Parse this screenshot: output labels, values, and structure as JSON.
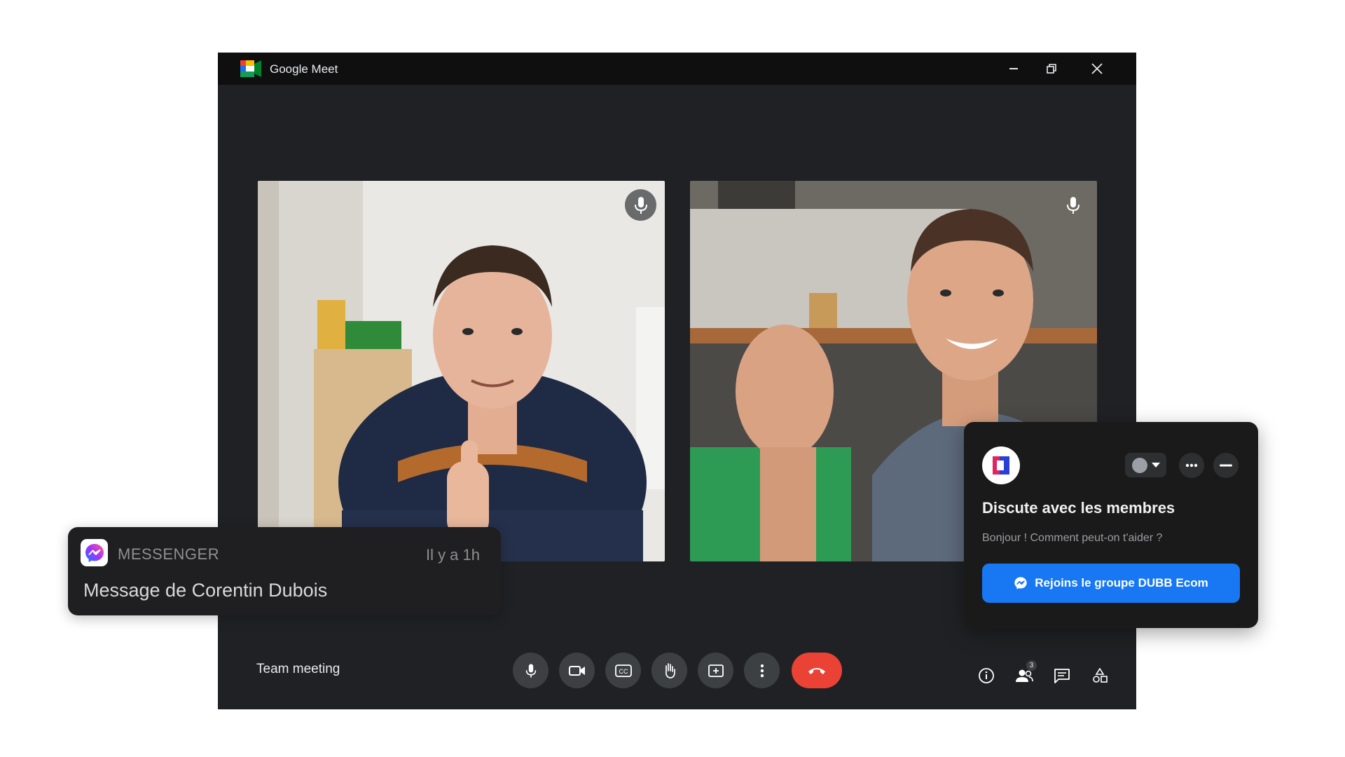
{
  "window": {
    "title": "Google Meet",
    "icons": {
      "logo": "google-meet-logo",
      "minimize": "minimize-icon",
      "restore": "restore-icon",
      "close": "close-icon"
    }
  },
  "meeting": {
    "name": "Team meeting",
    "participants_count": "3"
  },
  "tiles": [
    {
      "name": "participant-tile-left",
      "mic": "microphone-icon"
    },
    {
      "name": "participant-tile-right",
      "mic": "microphone-icon"
    }
  ],
  "controls": [
    "microphone-icon",
    "camera-icon",
    "captions-icon",
    "raise-hand-icon",
    "present-icon",
    "more-options-icon",
    "end-call-icon"
  ],
  "tools": [
    "info-icon",
    "people-icon",
    "chat-icon",
    "activities-icon"
  ],
  "notification": {
    "app": "MESSENGER",
    "time": "Il y a 1h",
    "message": "Message de Corentin Dubois",
    "icon": "messenger-icon"
  },
  "chat_widget": {
    "title": "Discute avec les membres",
    "subtitle": "Bonjour ! Comment peut-on t'aider ?",
    "cta": "Rejoins le groupe DUBB Ecom",
    "icons": [
      "brand-logo",
      "avatar-dropdown-icon",
      "more-icon",
      "minimize-icon",
      "messenger-icon"
    ]
  },
  "colors": {
    "window_bg": "#202124",
    "end_call": "#ea4335",
    "cta_blue": "#1877f2"
  }
}
